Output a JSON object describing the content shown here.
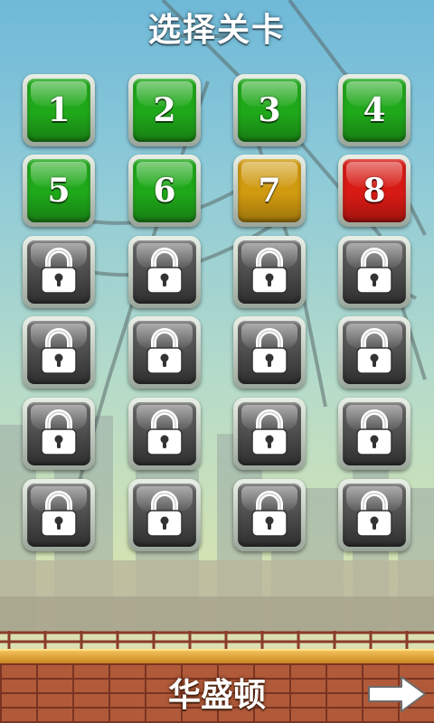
{
  "header": {
    "title": "选择关卡"
  },
  "levels": [
    {
      "label": "1",
      "state": "unlocked",
      "color": "#1fa81a"
    },
    {
      "label": "2",
      "state": "unlocked",
      "color": "#1fa81a"
    },
    {
      "label": "3",
      "state": "unlocked",
      "color": "#1fa81a"
    },
    {
      "label": "4",
      "state": "unlocked",
      "color": "#1fa81a"
    },
    {
      "label": "5",
      "state": "unlocked",
      "color": "#1fa81a"
    },
    {
      "label": "6",
      "state": "unlocked",
      "color": "#1fa81a"
    },
    {
      "label": "7",
      "state": "current",
      "color": "#d09a10"
    },
    {
      "label": "8",
      "state": "unlocked",
      "color": "#d81a14"
    },
    {
      "label": "",
      "state": "locked",
      "icon": "lock-icon"
    },
    {
      "label": "",
      "state": "locked",
      "icon": "lock-icon"
    },
    {
      "label": "",
      "state": "locked",
      "icon": "lock-icon"
    },
    {
      "label": "",
      "state": "locked",
      "icon": "lock-icon"
    },
    {
      "label": "",
      "state": "locked",
      "icon": "lock-icon"
    },
    {
      "label": "",
      "state": "locked",
      "icon": "lock-icon"
    },
    {
      "label": "",
      "state": "locked",
      "icon": "lock-icon"
    },
    {
      "label": "",
      "state": "locked",
      "icon": "lock-icon"
    },
    {
      "label": "",
      "state": "locked",
      "icon": "lock-icon"
    },
    {
      "label": "",
      "state": "locked",
      "icon": "lock-icon"
    },
    {
      "label": "",
      "state": "locked",
      "icon": "lock-icon"
    },
    {
      "label": "",
      "state": "locked",
      "icon": "lock-icon"
    },
    {
      "label": "",
      "state": "locked",
      "icon": "lock-icon"
    },
    {
      "label": "",
      "state": "locked",
      "icon": "lock-icon"
    },
    {
      "label": "",
      "state": "locked",
      "icon": "lock-icon"
    },
    {
      "label": "",
      "state": "locked",
      "icon": "lock-icon"
    }
  ],
  "footer": {
    "world_name": "华盛顿",
    "next_icon": "arrow-right-icon"
  },
  "colors": {
    "locked_tile": "#4a4a4a"
  }
}
